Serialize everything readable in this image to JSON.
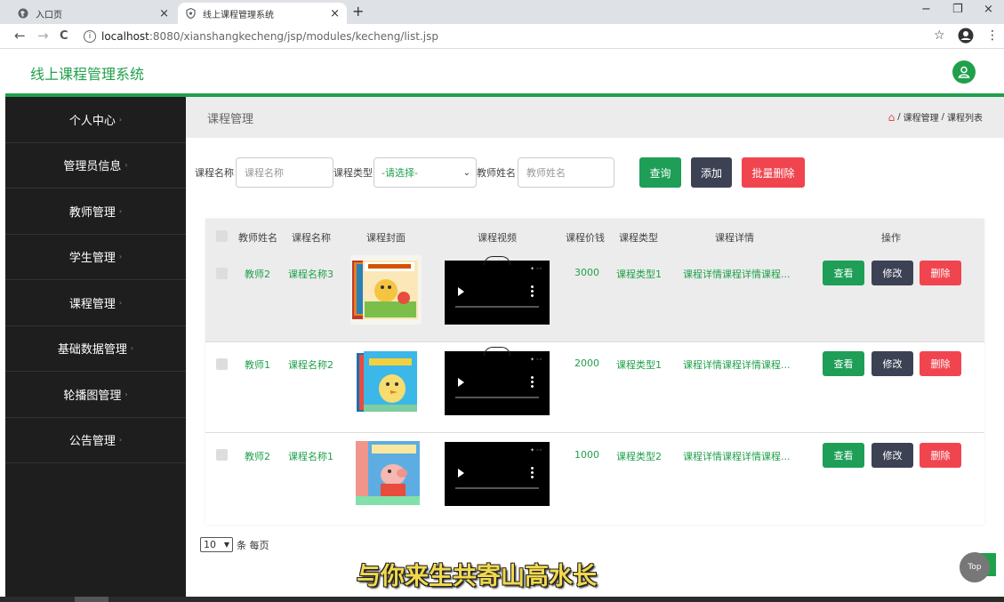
{
  "browser": {
    "tabs": [
      {
        "title": "入口页",
        "close": "×"
      },
      {
        "title": "线上课程管理系统",
        "close": "×"
      }
    ],
    "new_tab": "+",
    "window_controls": {
      "minimize": "−",
      "restore": "❐",
      "close": "×"
    },
    "nav": {
      "back": "←",
      "forward": "→",
      "reload": "C"
    },
    "url_host": "localhost",
    "url_rest": ":8080/xianshangkecheng/jsp/modules/kecheng/list.jsp",
    "bookmark_icon": "☆",
    "menu_icon": "⋮"
  },
  "app": {
    "title": "线上课程管理系统",
    "accent_color": "#20a04b"
  },
  "sidebar": {
    "items": [
      {
        "label": "个人中心"
      },
      {
        "label": "管理员信息"
      },
      {
        "label": "教师管理"
      },
      {
        "label": "学生管理"
      },
      {
        "label": "课程管理"
      },
      {
        "label": "基础数据管理"
      },
      {
        "label": "轮播图管理"
      },
      {
        "label": "公告管理"
      }
    ]
  },
  "breadcrumb": {
    "page_title": "课程管理",
    "home_icon": "⌂",
    "separator": "/",
    "level1": "课程管理",
    "level2": "课程列表"
  },
  "search": {
    "course_name_label": "课程名称",
    "course_name_placeholder": "课程名称",
    "course_type_label": "课程类型",
    "course_type_selected": "-请选择-",
    "teacher_name_label": "教师姓名",
    "teacher_name_placeholder": "教师姓名",
    "query_button": "查询",
    "add_button": "添加",
    "batch_delete_button": "批量删除"
  },
  "table": {
    "headers": [
      "教师姓名",
      "课程名称",
      "课程封面",
      "课程视频",
      "课程价钱",
      "课程类型",
      "课程详情",
      "操作"
    ],
    "rows": [
      {
        "teacher": "教师2",
        "course": "课程名称3",
        "price": "3000",
        "type": "课程类型1",
        "detail": "课程详情课程详情课程..."
      },
      {
        "teacher": "教师1",
        "course": "课程名称2",
        "price": "2000",
        "type": "课程类型1",
        "detail": "课程详情课程详情课程..."
      },
      {
        "teacher": "教师2",
        "course": "课程名称1",
        "price": "1000",
        "type": "课程类型2",
        "detail": "课程详情课程详情课程..."
      }
    ],
    "view_button": "查看",
    "edit_button": "修改",
    "delete_button": "删除"
  },
  "pager": {
    "page_size": "10",
    "suffix": "条 每页"
  },
  "top_button": "Top",
  "subtitle": "与你来生共寄山高水长"
}
